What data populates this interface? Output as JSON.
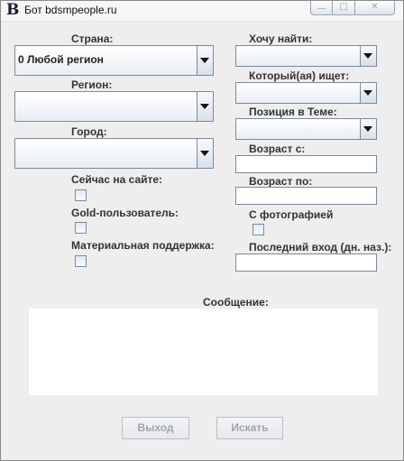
{
  "window": {
    "logo": "B",
    "title": "Бот bdsmpeople.ru",
    "controls": {
      "minimize": "—",
      "maximize": "□",
      "close": "✕"
    }
  },
  "left": {
    "country": {
      "label": "Страна:",
      "value": "0 Любой регион"
    },
    "region": {
      "label": "Регион:",
      "value": ""
    },
    "city": {
      "label": "Город:",
      "value": ""
    },
    "online_now": {
      "label": "Сейчас на сайте:",
      "checked": false
    },
    "gold_user": {
      "label": "Gold-пользователь:",
      "checked": false
    },
    "financial_support": {
      "label": "Материальная поддержка:",
      "checked": false
    }
  },
  "right": {
    "want_to_find": {
      "label": "Хочу найти:",
      "value": ""
    },
    "who_seeks": {
      "label": "Который(ая) ищет:",
      "value": ""
    },
    "position": {
      "label": "Позиция в Теме:",
      "value": ""
    },
    "age_from": {
      "label": "Возраст с:",
      "value": ""
    },
    "age_to": {
      "label": "Возраст по:",
      "value": ""
    },
    "with_photo": {
      "label": "С фотографией",
      "checked": false
    },
    "last_login": {
      "label": "Последний вход (дн. наз.):",
      "value": ""
    }
  },
  "message": {
    "label": "Сообщение:",
    "value": ""
  },
  "buttons": {
    "exit": "Выход",
    "search": "Искать"
  },
  "colors": {
    "window_bg": "#eeeeee",
    "field_border": "#7a8a99",
    "disabled_text": "#a0a4aa"
  }
}
